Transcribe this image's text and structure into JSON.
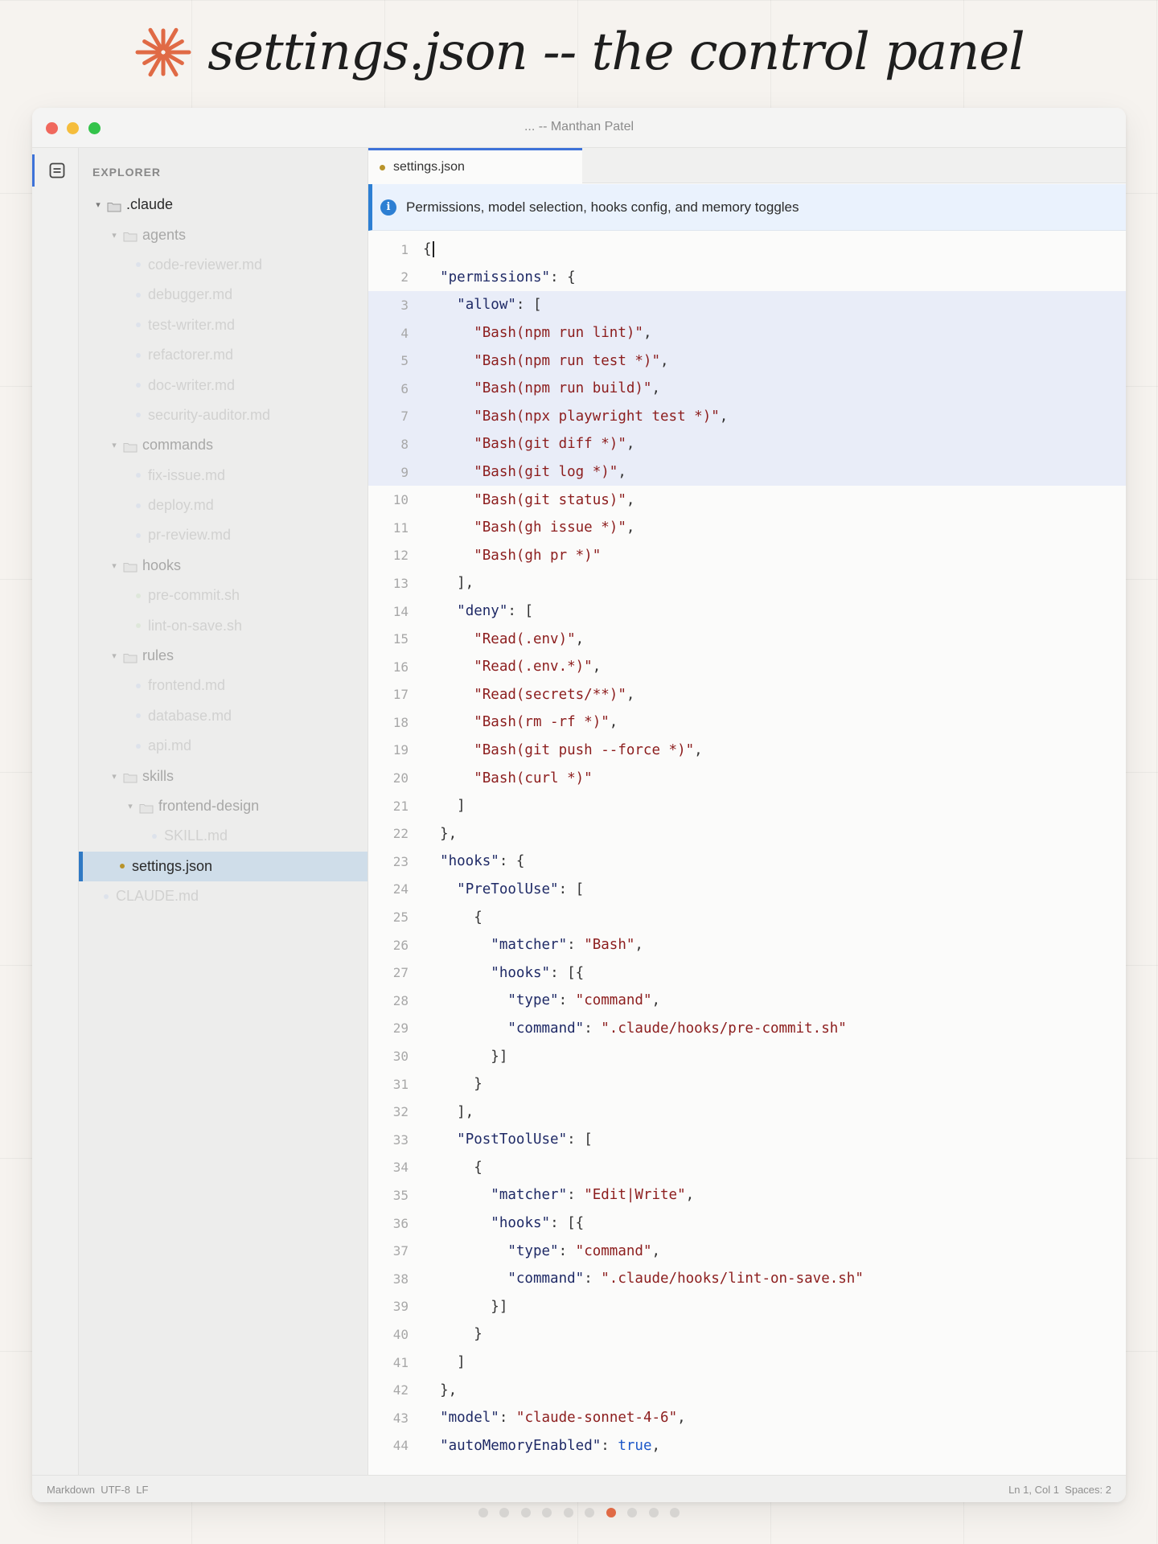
{
  "headline": {
    "text": "settings.json -- the control panel",
    "accent_color": "#e06a45",
    "icon": "asterisk-burst-icon"
  },
  "window": {
    "title": "... -- Manthan Patel"
  },
  "activity_bar": {
    "active_icon": "explorer-files-icon"
  },
  "sidebar": {
    "title": "EXPLORER",
    "tree": [
      {
        "type": "folder",
        "label": ".claude",
        "level": 0,
        "state": "normal"
      },
      {
        "type": "folder",
        "label": "agents",
        "level": 1,
        "state": "faded"
      },
      {
        "type": "file",
        "label": "code-reviewer.md",
        "level": 2,
        "state": "faded2",
        "dot": "#9bb6e8"
      },
      {
        "type": "file",
        "label": "debugger.md",
        "level": 2,
        "state": "faded2",
        "dot": "#9bb6e8"
      },
      {
        "type": "file",
        "label": "test-writer.md",
        "level": 2,
        "state": "faded2",
        "dot": "#9bb6e8"
      },
      {
        "type": "file",
        "label": "refactorer.md",
        "level": 2,
        "state": "faded2",
        "dot": "#9bb6e8"
      },
      {
        "type": "file",
        "label": "doc-writer.md",
        "level": 2,
        "state": "faded2",
        "dot": "#9bb6e8"
      },
      {
        "type": "file",
        "label": "security-auditor.md",
        "level": 2,
        "state": "faded2",
        "dot": "#9bb6e8"
      },
      {
        "type": "folder",
        "label": "commands",
        "level": 1,
        "state": "faded"
      },
      {
        "type": "file",
        "label": "fix-issue.md",
        "level": 2,
        "state": "faded2",
        "dot": "#9bb6e8"
      },
      {
        "type": "file",
        "label": "deploy.md",
        "level": 2,
        "state": "faded2",
        "dot": "#9bb6e8"
      },
      {
        "type": "file",
        "label": "pr-review.md",
        "level": 2,
        "state": "faded2",
        "dot": "#9bb6e8"
      },
      {
        "type": "folder",
        "label": "hooks",
        "level": 1,
        "state": "faded"
      },
      {
        "type": "file",
        "label": "pre-commit.sh",
        "level": 2,
        "state": "faded2",
        "dot": "#9ccf8a"
      },
      {
        "type": "file",
        "label": "lint-on-save.sh",
        "level": 2,
        "state": "faded2",
        "dot": "#9ccf8a"
      },
      {
        "type": "folder",
        "label": "rules",
        "level": 1,
        "state": "faded"
      },
      {
        "type": "file",
        "label": "frontend.md",
        "level": 2,
        "state": "faded2",
        "dot": "#9bb6e8"
      },
      {
        "type": "file",
        "label": "database.md",
        "level": 2,
        "state": "faded2",
        "dot": "#9bb6e8"
      },
      {
        "type": "file",
        "label": "api.md",
        "level": 2,
        "state": "faded2",
        "dot": "#9bb6e8"
      },
      {
        "type": "folder",
        "label": "skills",
        "level": 1,
        "state": "faded"
      },
      {
        "type": "folder",
        "label": "frontend-design",
        "level": 2,
        "state": "faded"
      },
      {
        "type": "file",
        "label": "SKILL.md",
        "level": 3,
        "state": "faded2",
        "dot": "#9bb6e8"
      },
      {
        "type": "file",
        "label": "settings.json",
        "level": 1,
        "state": "selected",
        "dot": "#b8932a"
      },
      {
        "type": "file",
        "label": "CLAUDE.md",
        "level": 0,
        "state": "faded2",
        "dot": "#9bb6e8"
      }
    ]
  },
  "editor": {
    "tab": {
      "label": "settings.json",
      "dot": "#b8932a"
    },
    "banner": "Permissions, model selection, hooks config, and memory toggles",
    "highlight_lines": [
      3,
      4,
      5,
      6,
      7,
      8,
      9
    ],
    "lines": [
      [
        [
          "p",
          "{"
        ]
      ],
      [
        [
          "p",
          "  "
        ],
        [
          "k",
          "\"permissions\""
        ],
        [
          "p",
          ": {"
        ]
      ],
      [
        [
          "p",
          "    "
        ],
        [
          "k",
          "\"allow\""
        ],
        [
          "p",
          ": ["
        ]
      ],
      [
        [
          "p",
          "      "
        ],
        [
          "s",
          "\"Bash(npm run lint)\""
        ],
        [
          "p",
          ","
        ]
      ],
      [
        [
          "p",
          "      "
        ],
        [
          "s",
          "\"Bash(npm run test *)\""
        ],
        [
          "p",
          ","
        ]
      ],
      [
        [
          "p",
          "      "
        ],
        [
          "s",
          "\"Bash(npm run build)\""
        ],
        [
          "p",
          ","
        ]
      ],
      [
        [
          "p",
          "      "
        ],
        [
          "s",
          "\"Bash(npx playwright test *)\""
        ],
        [
          "p",
          ","
        ]
      ],
      [
        [
          "p",
          "      "
        ],
        [
          "s",
          "\"Bash(git diff *)\""
        ],
        [
          "p",
          ","
        ]
      ],
      [
        [
          "p",
          "      "
        ],
        [
          "s",
          "\"Bash(git log *)\""
        ],
        [
          "p",
          ","
        ]
      ],
      [
        [
          "p",
          "      "
        ],
        [
          "s",
          "\"Bash(git status)\""
        ],
        [
          "p",
          ","
        ]
      ],
      [
        [
          "p",
          "      "
        ],
        [
          "s",
          "\"Bash(gh issue *)\""
        ],
        [
          "p",
          ","
        ]
      ],
      [
        [
          "p",
          "      "
        ],
        [
          "s",
          "\"Bash(gh pr *)\""
        ]
      ],
      [
        [
          "p",
          "    ],"
        ]
      ],
      [
        [
          "p",
          "    "
        ],
        [
          "k",
          "\"deny\""
        ],
        [
          "p",
          ": ["
        ]
      ],
      [
        [
          "p",
          "      "
        ],
        [
          "s",
          "\"Read(.env)\""
        ],
        [
          "p",
          ","
        ]
      ],
      [
        [
          "p",
          "      "
        ],
        [
          "s",
          "\"Read(.env.*)\""
        ],
        [
          "p",
          ","
        ]
      ],
      [
        [
          "p",
          "      "
        ],
        [
          "s",
          "\"Read(secrets/**)\""
        ],
        [
          "p",
          ","
        ]
      ],
      [
        [
          "p",
          "      "
        ],
        [
          "s",
          "\"Bash(rm -rf *)\""
        ],
        [
          "p",
          ","
        ]
      ],
      [
        [
          "p",
          "      "
        ],
        [
          "s",
          "\"Bash(git push --force *)\""
        ],
        [
          "p",
          ","
        ]
      ],
      [
        [
          "p",
          "      "
        ],
        [
          "s",
          "\"Bash(curl *)\""
        ]
      ],
      [
        [
          "p",
          "    ]"
        ]
      ],
      [
        [
          "p",
          "  },"
        ]
      ],
      [
        [
          "p",
          "  "
        ],
        [
          "k",
          "\"hooks\""
        ],
        [
          "p",
          ": {"
        ]
      ],
      [
        [
          "p",
          "    "
        ],
        [
          "k",
          "\"PreToolUse\""
        ],
        [
          "p",
          ": ["
        ]
      ],
      [
        [
          "p",
          "      {"
        ]
      ],
      [
        [
          "p",
          "        "
        ],
        [
          "k",
          "\"matcher\""
        ],
        [
          "p",
          ": "
        ],
        [
          "s",
          "\"Bash\""
        ],
        [
          "p",
          ","
        ]
      ],
      [
        [
          "p",
          "        "
        ],
        [
          "k",
          "\"hooks\""
        ],
        [
          "p",
          ": [{"
        ]
      ],
      [
        [
          "p",
          "          "
        ],
        [
          "k",
          "\"type\""
        ],
        [
          "p",
          ": "
        ],
        [
          "s",
          "\"command\""
        ],
        [
          "p",
          ","
        ]
      ],
      [
        [
          "p",
          "          "
        ],
        [
          "k",
          "\"command\""
        ],
        [
          "p",
          ": "
        ],
        [
          "s",
          "\".claude/hooks/pre-commit.sh\""
        ]
      ],
      [
        [
          "p",
          "        }]"
        ]
      ],
      [
        [
          "p",
          "      }"
        ]
      ],
      [
        [
          "p",
          "    ],"
        ]
      ],
      [
        [
          "p",
          "    "
        ],
        [
          "k",
          "\"PostToolUse\""
        ],
        [
          "p",
          ": ["
        ]
      ],
      [
        [
          "p",
          "      {"
        ]
      ],
      [
        [
          "p",
          "        "
        ],
        [
          "k",
          "\"matcher\""
        ],
        [
          "p",
          ": "
        ],
        [
          "s",
          "\"Edit|Write\""
        ],
        [
          "p",
          ","
        ]
      ],
      [
        [
          "p",
          "        "
        ],
        [
          "k",
          "\"hooks\""
        ],
        [
          "p",
          ": [{"
        ]
      ],
      [
        [
          "p",
          "          "
        ],
        [
          "k",
          "\"type\""
        ],
        [
          "p",
          ": "
        ],
        [
          "s",
          "\"command\""
        ],
        [
          "p",
          ","
        ]
      ],
      [
        [
          "p",
          "          "
        ],
        [
          "k",
          "\"command\""
        ],
        [
          "p",
          ": "
        ],
        [
          "s",
          "\".claude/hooks/lint-on-save.sh\""
        ]
      ],
      [
        [
          "p",
          "        }]"
        ]
      ],
      [
        [
          "p",
          "      }"
        ]
      ],
      [
        [
          "p",
          "    ]"
        ]
      ],
      [
        [
          "p",
          "  },"
        ]
      ],
      [
        [
          "p",
          "  "
        ],
        [
          "k",
          "\"model\""
        ],
        [
          "p",
          ": "
        ],
        [
          "s",
          "\"claude-sonnet-4-6\""
        ],
        [
          "p",
          ","
        ]
      ],
      [
        [
          "p",
          "  "
        ],
        [
          "k",
          "\"autoMemoryEnabled\""
        ],
        [
          "p",
          ": "
        ],
        [
          "b",
          "true"
        ],
        [
          "p",
          ","
        ]
      ]
    ]
  },
  "statusbar": {
    "left": "Markdown  UTF-8  LF",
    "right": "Ln 1, Col 1  Spaces: 2"
  },
  "pager": {
    "count": 10,
    "active_index": 6
  }
}
